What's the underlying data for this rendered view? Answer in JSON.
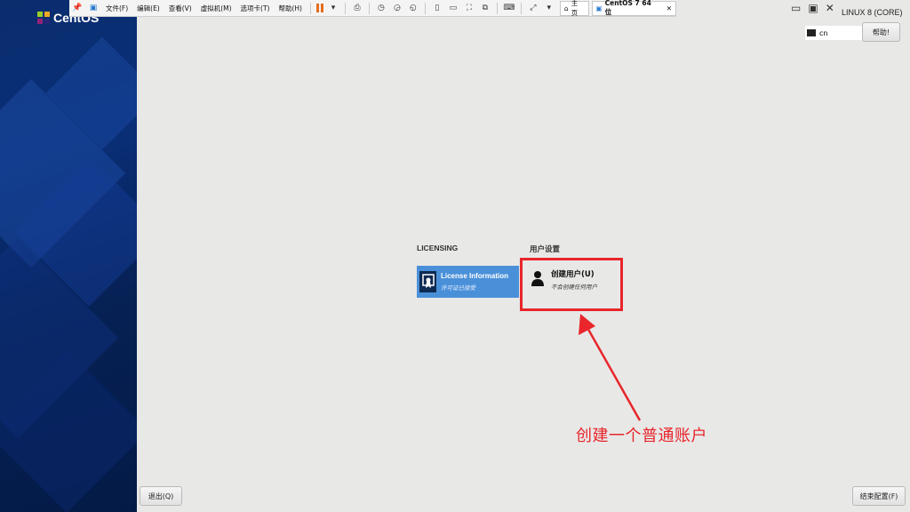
{
  "brand": {
    "logo_text": "CentOS"
  },
  "vm_toolbar": {
    "menus": [
      "文件(F)",
      "编辑(E)",
      "查看(V)",
      "虚拟机(M)",
      "选项卡(T)",
      "帮助(H)"
    ],
    "tabs": [
      {
        "label": "主页"
      },
      {
        "label": "CentOS 7 64 位"
      }
    ],
    "accent_pause": "#e46d1a"
  },
  "header": {
    "os_name": "LINUX 8 (CORE)",
    "keyboard_layout": "cn",
    "help_label": "帮助!"
  },
  "hub": {
    "licensing": {
      "title": "LICENSING",
      "spoke_title": "License Information",
      "spoke_status": "许可证已接受",
      "accent": "#4a90d9"
    },
    "user_settings": {
      "title": "用户设置",
      "spoke_title": "创建用户(U)",
      "spoke_status": "不会创建任何用户"
    }
  },
  "annotation": {
    "text": "创建一个普通账户",
    "color": "#e8262b"
  },
  "footer": {
    "quit_label": "退出(Q)",
    "finish_label": "结束配置(F)"
  }
}
